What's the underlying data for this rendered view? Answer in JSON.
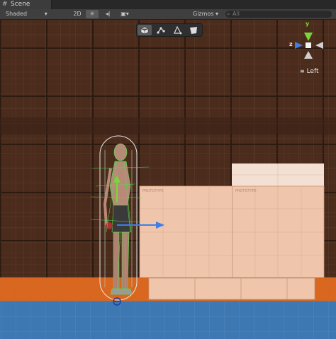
{
  "window": {
    "tab_label": "Scene",
    "tab_icon": "scene-grid-icon"
  },
  "toolbar": {
    "shading_mode": "Shaded",
    "mode_2d": "2D",
    "lighting_icon": "sun-icon",
    "audio_icon": "speaker-icon",
    "effects_icon": "image-icon",
    "gizmos_label": "Gizmos",
    "search_placeholder": "All",
    "search_icon": "search-icon"
  },
  "overlay_tools": [
    {
      "icon": "cube-icon",
      "selected": true
    },
    {
      "icon": "bones-icon",
      "selected": false
    },
    {
      "icon": "triangle-icon",
      "selected": false
    },
    {
      "icon": "plane-icon",
      "selected": false
    }
  ],
  "orientation_gizmo": {
    "view_label": "Left",
    "axis_y": "y",
    "axis_z": "z"
  },
  "prototype_text": "PROTOTYPE",
  "colors": {
    "background": "#4a2b1c",
    "floor_orange": "#d9671f",
    "water_blue": "#3e78b2",
    "boxes": "#efc6ac",
    "top_box": "#f3e0d2",
    "collider": "#4de04d",
    "axis_y": "#7cd63a",
    "axis_z": "#3d7ee8"
  }
}
